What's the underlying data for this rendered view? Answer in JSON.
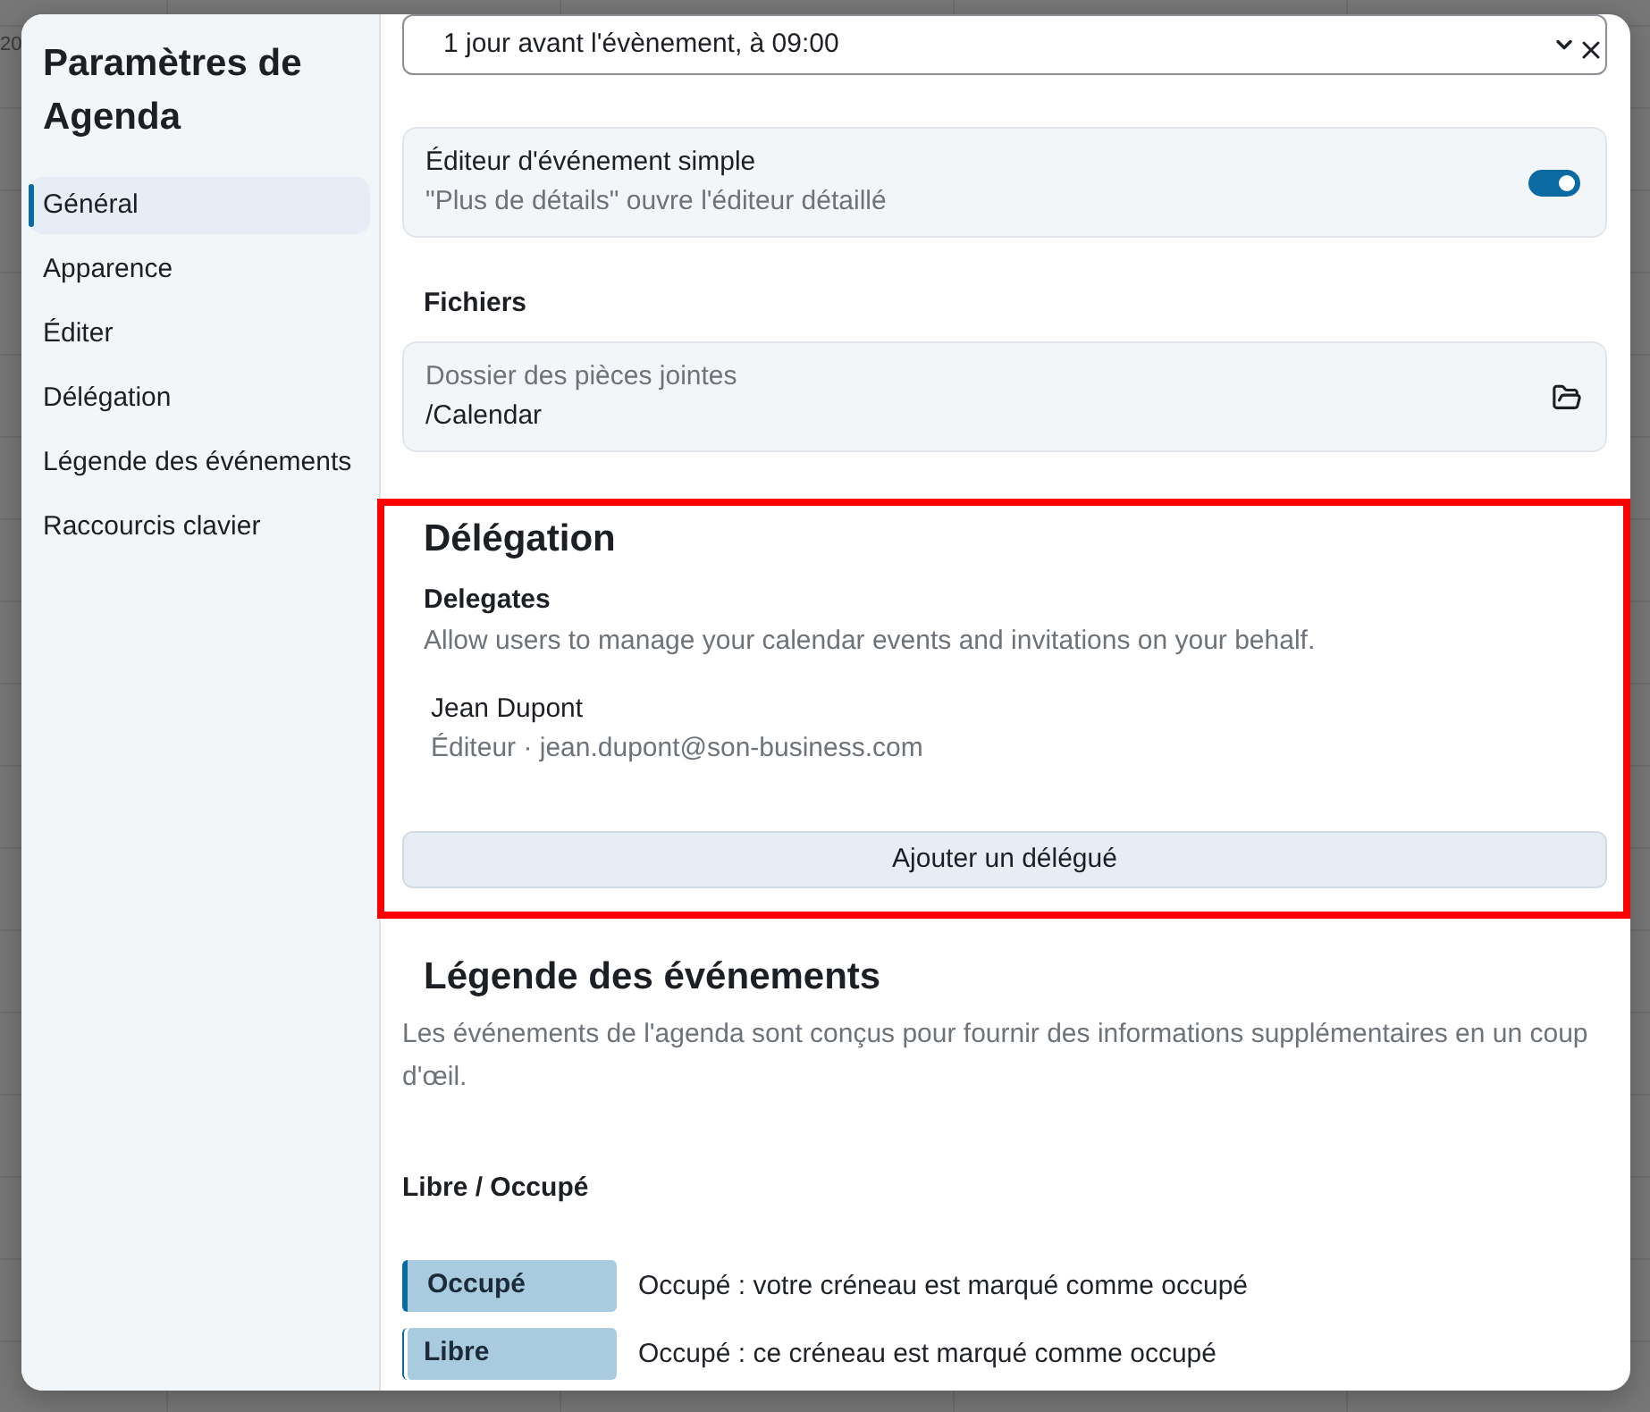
{
  "background": {
    "fragment": "20"
  },
  "sidebar": {
    "title": "Paramètres de Agenda",
    "items": [
      {
        "label": "Général",
        "selected": true
      },
      {
        "label": "Apparence",
        "selected": false
      },
      {
        "label": "Éditer",
        "selected": false
      },
      {
        "label": "Délégation",
        "selected": false
      },
      {
        "label": "Légende des événements",
        "selected": false
      },
      {
        "label": "Raccourcis clavier",
        "selected": false
      }
    ]
  },
  "reminder_select": {
    "value": "1 jour avant l'évènement, à 09:00"
  },
  "simple_editor": {
    "title": "Éditeur d'événement simple",
    "description": "\"Plus de détails\" ouvre l'éditeur détaillé",
    "on": true
  },
  "files": {
    "heading": "Fichiers",
    "folder_label": "Dossier des pièces jointes",
    "folder_path": "/Calendar"
  },
  "delegation": {
    "highlighted": true,
    "title": "Délégation",
    "subtitle": "Delegates",
    "description": "Allow users to manage your calendar events and invitations on your behalf.",
    "delegates": [
      {
        "name": "Jean Dupont",
        "details": "Éditeur · jean.dupont@son-business.com"
      }
    ],
    "add_button": "Ajouter un délégué"
  },
  "legend": {
    "title": "Légende des événements",
    "description": "Les événements de l'agenda sont conçus pour fournir des informations supplémentaires en un coup d'œil.",
    "group_heading": "Libre / Occupé",
    "items": [
      {
        "kind": "busy",
        "label": "Occupé",
        "description": "Occupé : votre créneau est marqué comme occupé"
      },
      {
        "kind": "free",
        "label": "Libre",
        "description": "Occupé : ce créneau est marqué comme occupé"
      }
    ]
  }
}
